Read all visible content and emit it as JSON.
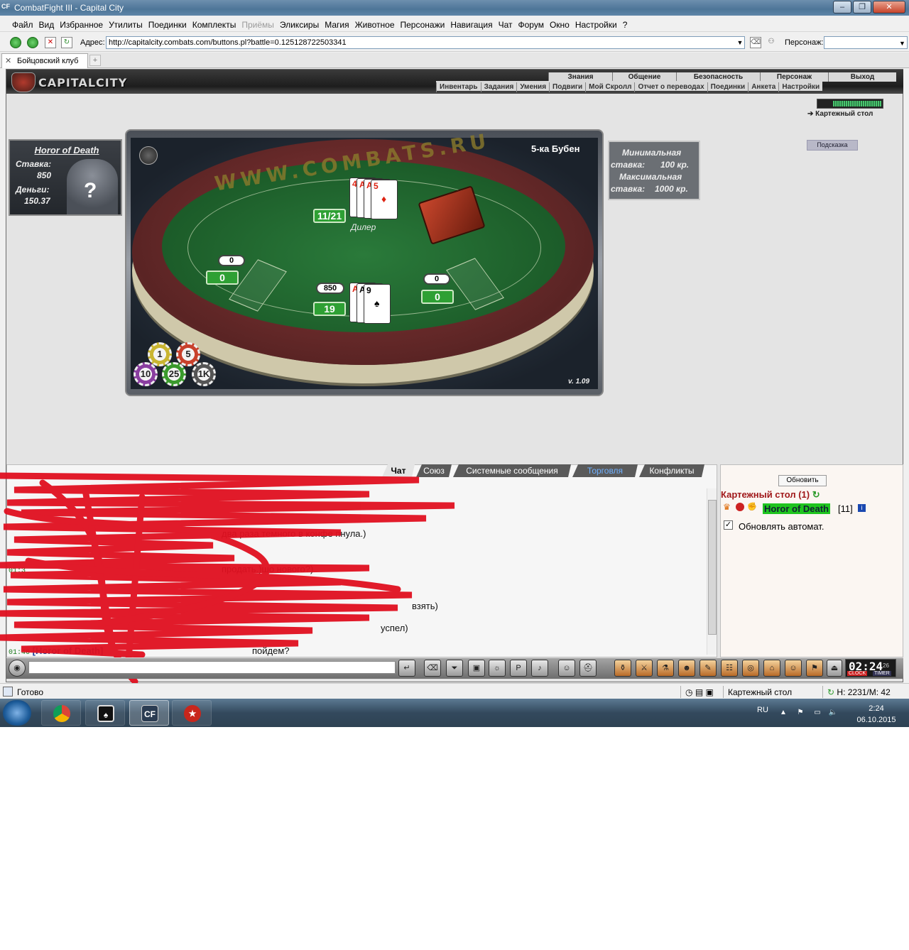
{
  "window": {
    "icon_text": "CF",
    "title": "CombatFight III - Capital City",
    "buttons": [
      "–",
      "❐",
      "✕"
    ]
  },
  "menu": [
    {
      "label": "Файл"
    },
    {
      "label": "Вид"
    },
    {
      "label": "Избранное"
    },
    {
      "label": "Утилиты"
    },
    {
      "label": "Поединки"
    },
    {
      "label": "Комплекты"
    },
    {
      "label": "Приёмы",
      "disabled": true
    },
    {
      "label": "Эликсиры"
    },
    {
      "label": "Магия"
    },
    {
      "label": "Животное"
    },
    {
      "label": "Персонажи"
    },
    {
      "label": "Навигация"
    },
    {
      "label": "Чат"
    },
    {
      "label": "Форум"
    },
    {
      "label": "Окно"
    },
    {
      "label": "Настройки"
    },
    {
      "label": "?"
    }
  ],
  "address": {
    "label": "Адрес:",
    "url": "http://capitalcity.combats.com/buttons.pl?battle=0.125128722503341",
    "persona_label": "Персонаж:",
    "persona_value": ""
  },
  "tabs": [
    {
      "label": "Бойцовский клуб",
      "close": "✕"
    }
  ],
  "tab_add": "+",
  "site": {
    "logo_text": "CAPITALCITY",
    "top_nav": [
      "Знания",
      "Общение",
      "Безопасность",
      "Персонаж",
      "Выход"
    ],
    "sub_nav": [
      "Инвентарь",
      "Задания",
      "Умения",
      "Подвиги",
      "Мой Скролл",
      "Отчет о переводах",
      "Поединки",
      "Анкета",
      "Настройки"
    ],
    "location_link": "Картежный стол",
    "hint_button": "Подсказка"
  },
  "player_card": {
    "name": "Horor of Death",
    "stake_label": "Ставка:",
    "stake": "850",
    "money_label": "Деньги:",
    "money": "150.37",
    "unknown_mark": "?"
  },
  "table": {
    "watermark": "WWW.COMBATS.RU",
    "game_name": "5-ка Бубен",
    "version": "v. 1.09",
    "dealer_label": "Дилер",
    "dealer_score": "11/21",
    "dealer_cards": [
      {
        "rank": "4",
        "suit": "♥",
        "color": "red"
      },
      {
        "rank": "A",
        "suit": "♥",
        "color": "red"
      },
      {
        "rank": "A",
        "suit": "♦",
        "color": "red"
      },
      {
        "rank": "5",
        "suit": "♦",
        "color": "red"
      }
    ],
    "left_seat": {
      "bet": "0",
      "score": "0"
    },
    "right_seat": {
      "bet": "0",
      "score": "0"
    },
    "player_seat": {
      "bet": "850",
      "score": "19"
    },
    "player_cards": [
      {
        "rank": "A",
        "suit": "♥",
        "color": "red"
      },
      {
        "rank": "A",
        "suit": "♣",
        "color": "black"
      },
      {
        "rank": "9",
        "suit": "♠",
        "color": "black"
      }
    ],
    "chips": [
      {
        "label": "1",
        "color": "#c9b531"
      },
      {
        "label": "5",
        "color": "#c8412c"
      },
      {
        "label": "10",
        "color": "#8a3ea0"
      },
      {
        "label": "25",
        "color": "#3a9a2c"
      },
      {
        "label": "1K",
        "color": "#555555"
      }
    ]
  },
  "limits": {
    "min_label_1": "Минимальная",
    "min_label_2": "ставка:",
    "min_value": "100 кр.",
    "max_label_1": "Максимальная",
    "max_label_2": "ставка:",
    "max_value": "1000 кр."
  },
  "chat": {
    "tabs": [
      {
        "label": "Чат",
        "active": true
      },
      {
        "label": "Союз"
      },
      {
        "label": "Системные сообщения"
      },
      {
        "label": "Торговля",
        "blue": true
      },
      {
        "label": "Конфликты"
      }
    ],
    "lines": [
      {
        "time": "",
        "nick": "",
        "text": "два раза темного в конфе пнула.)"
      },
      {
        "time": "01:3",
        "nick": "",
        "text": "продать.)шо нового?)"
      },
      {
        "time": "",
        "nick": "",
        "text": "взять)"
      },
      {
        "time": "",
        "nick": "",
        "text": "успел)"
      },
      {
        "time": "01:46",
        "nick": "[Horor of Death]",
        "text": "пойдем?"
      }
    ]
  },
  "room": {
    "refresh_button": "Обновить",
    "title": "Картежный стол",
    "count": "(1)",
    "player_name": "Horor of Death",
    "player_level": "[11]",
    "info_icon": "i",
    "auto_checked": true,
    "auto_label": "Обновлять автомат."
  },
  "toolbar": {
    "clock_time": "02:24",
    "clock_seconds": "26",
    "clock_label": "CLOCK",
    "timer_label": "TIMER"
  },
  "status": {
    "text": "Готово",
    "location": "Картежный стол",
    "stats": "Н: 2231/М: 42"
  },
  "taskbar": {
    "lang": "RU",
    "time": "2:24",
    "date": "06.10.2015",
    "apps": [
      "chrome",
      "poker",
      "CF",
      "pokerstars"
    ]
  }
}
